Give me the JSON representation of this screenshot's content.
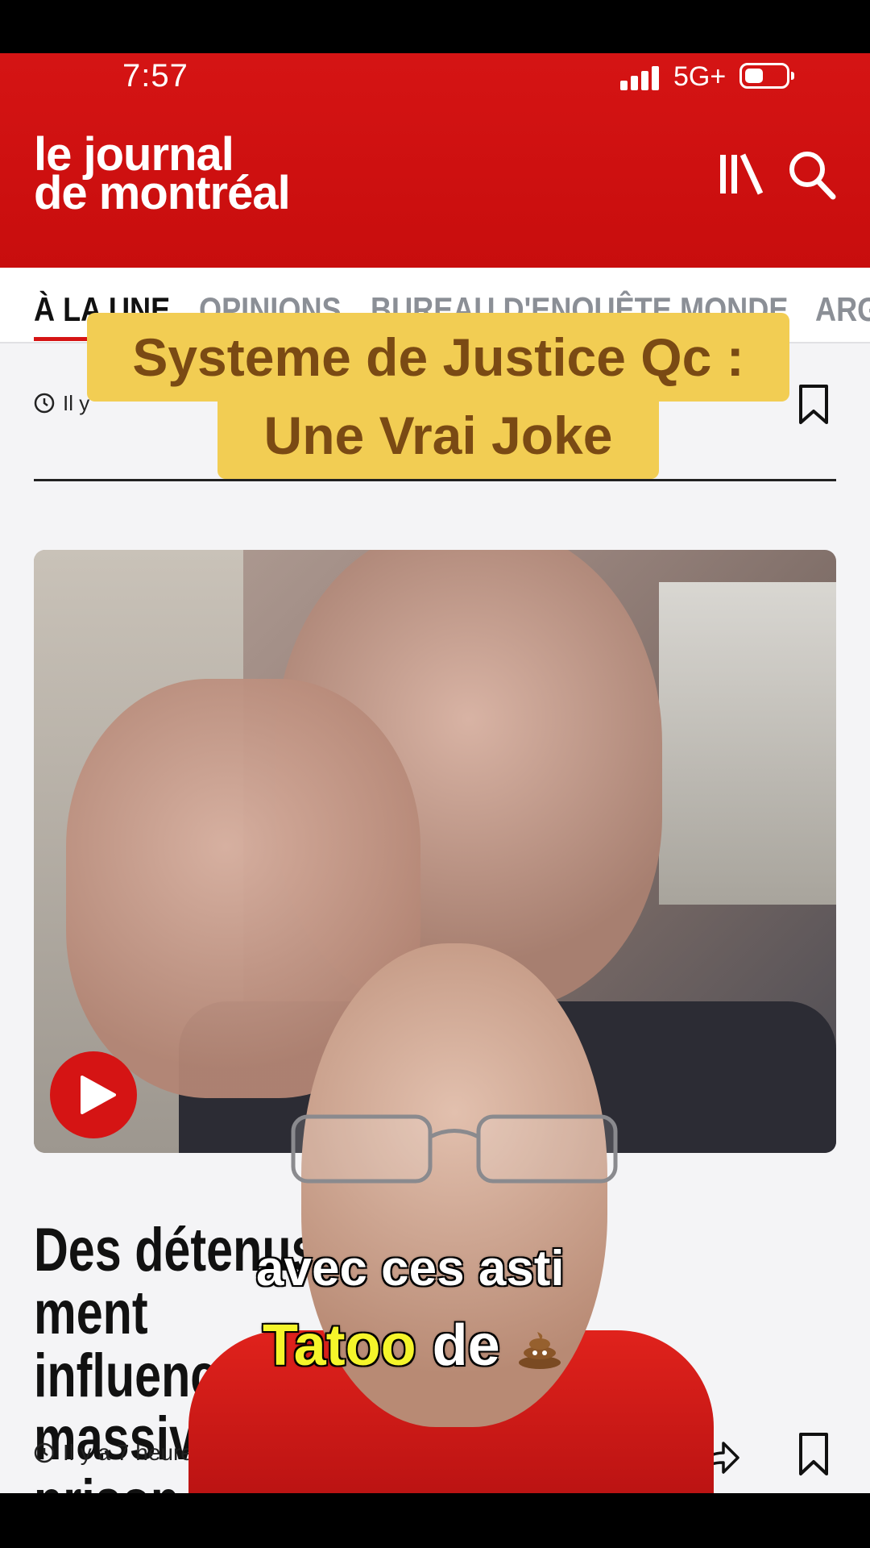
{
  "status_bar": {
    "time": "7:57",
    "network": "5G+"
  },
  "header": {
    "logo_line1": "le journal",
    "logo_line2": "de montréal"
  },
  "tabs": [
    {
      "label": "À LA UNE",
      "active": true
    },
    {
      "label": "OPINIONS",
      "active": false
    },
    {
      "label": "BUREAU D'ENQUÊTE",
      "active": false
    },
    {
      "label": "MONDE",
      "active": false
    },
    {
      "label": "ARG",
      "active": false
    }
  ],
  "top_meta": {
    "time_fragment": "Il y"
  },
  "caption": {
    "line1": "Systeme de Justice Qc :",
    "line2": "Une Vrai Joke"
  },
  "article": {
    "headline_line1_a": "Des détenus",
    "headline_line1_b": "ment",
    "headline_line2_a": "influencer",
    "headline_line2_b": "e",
    "headline_line3_a": "massive d",
    "headline_line3_b": "en prison",
    "time": "Il y a 7 heures"
  },
  "subtitles": {
    "line1": "avec ces asti",
    "line2_highlight": "Tatoo",
    "line2_rest": "de"
  },
  "colors": {
    "brand_red": "#d51414",
    "caption_yellow": "#f2cd53",
    "caption_text": "#7a4a14",
    "subtitle_highlight": "#f5f52a"
  }
}
